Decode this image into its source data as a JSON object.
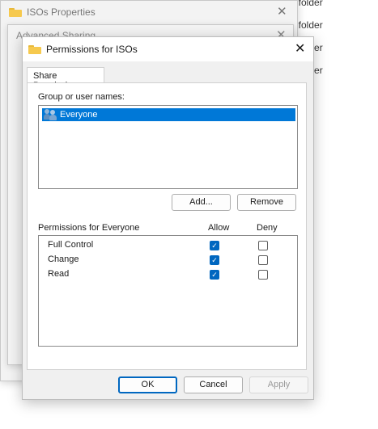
{
  "background": {
    "rows": [
      "le folder",
      "le folder",
      "le folder",
      "le folder"
    ]
  },
  "props_window": {
    "title": "ISOs Properties",
    "close_glyph": "✕"
  },
  "adv_window": {
    "title": "Advanced Sharing",
    "close_glyph": "✕"
  },
  "dialog": {
    "title": "Permissions for ISOs",
    "close_glyph": "✕",
    "tab_label": "Share Permissions",
    "group_label": "Group or user names:",
    "users": [
      {
        "name": "Everyone",
        "icon": "users-icon",
        "selected": true
      }
    ],
    "add_label": "Add...",
    "remove_label": "Remove",
    "perm_header": "Permissions for Everyone",
    "allow_header": "Allow",
    "deny_header": "Deny",
    "permissions": [
      {
        "name": "Full Control",
        "allow": true,
        "deny": false
      },
      {
        "name": "Change",
        "allow": true,
        "deny": false
      },
      {
        "name": "Read",
        "allow": true,
        "deny": false
      }
    ],
    "ok_label": "OK",
    "cancel_label": "Cancel",
    "apply_label": "Apply"
  },
  "colors": {
    "accent": "#0078d7",
    "checkbox": "#0067c0",
    "folder": "#f6c94e"
  }
}
